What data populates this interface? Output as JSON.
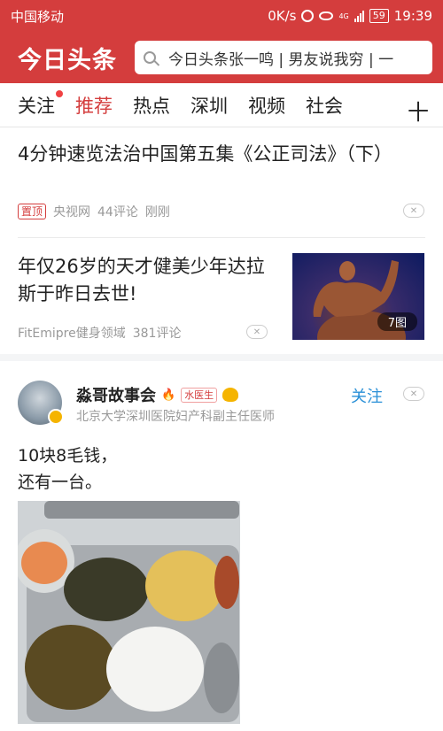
{
  "status_bar": {
    "carrier": "中国移动",
    "speed": "0K/s",
    "network": "4G",
    "battery": "59",
    "time": "19:39"
  },
  "header": {
    "logo": "今日头条",
    "search_text": "今日头条张一鸣 | 男友说我穷 | 一"
  },
  "tabs": [
    {
      "label": "关注"
    },
    {
      "label": "推荐"
    },
    {
      "label": "热点"
    },
    {
      "label": "深圳"
    },
    {
      "label": "视频"
    },
    {
      "label": "社会"
    }
  ],
  "tab_more": "十",
  "articles": [
    {
      "title": "4分钟速览法治中国第五集《公正司法》（下）",
      "pin": "置顶",
      "source": "央视网",
      "comments": "44评论",
      "time": "刚刚"
    },
    {
      "title": "年仅26岁的天才健美少年达拉斯于昨日去世!",
      "source": "FitEmipre健身领域",
      "comments": "381评论",
      "image_count": "7图"
    }
  ],
  "post": {
    "author": "淼哥故事会",
    "author_tag": "水医生",
    "subtitle": "北京大学深圳医院妇产科副主任医师",
    "follow": "关注",
    "text": "10块8毛钱，\n还有一台。"
  },
  "icons": {
    "dislike": "close-icon",
    "search": "search-icon"
  },
  "colors": {
    "brand_red": "#d43d3d",
    "follow_blue": "#2a90d7"
  }
}
